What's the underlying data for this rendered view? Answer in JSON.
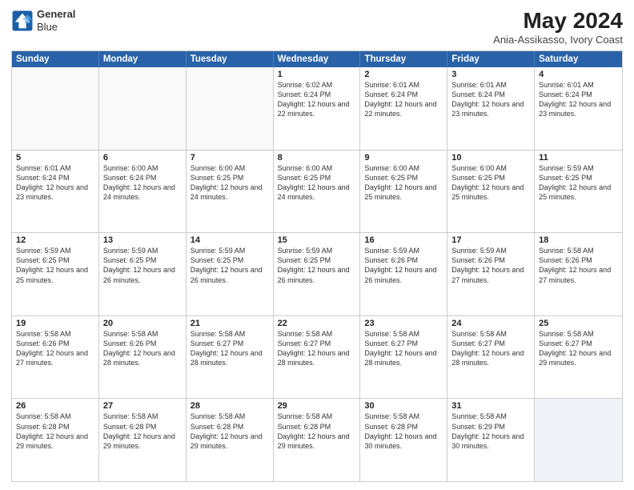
{
  "logo": {
    "line1": "General",
    "line2": "Blue"
  },
  "title": "May 2024",
  "subtitle": "Ania-Assikasso, Ivory Coast",
  "header_days": [
    "Sunday",
    "Monday",
    "Tuesday",
    "Wednesday",
    "Thursday",
    "Friday",
    "Saturday"
  ],
  "weeks": [
    {
      "cells": [
        {
          "day": "",
          "info": "",
          "empty": true
        },
        {
          "day": "",
          "info": "",
          "empty": true
        },
        {
          "day": "",
          "info": "",
          "empty": true
        },
        {
          "day": "1",
          "info": "Sunrise: 6:02 AM\nSunset: 6:24 PM\nDaylight: 12 hours\nand 22 minutes."
        },
        {
          "day": "2",
          "info": "Sunrise: 6:01 AM\nSunset: 6:24 PM\nDaylight: 12 hours\nand 22 minutes."
        },
        {
          "day": "3",
          "info": "Sunrise: 6:01 AM\nSunset: 6:24 PM\nDaylight: 12 hours\nand 23 minutes."
        },
        {
          "day": "4",
          "info": "Sunrise: 6:01 AM\nSunset: 6:24 PM\nDaylight: 12 hours\nand 23 minutes."
        }
      ]
    },
    {
      "cells": [
        {
          "day": "5",
          "info": "Sunrise: 6:01 AM\nSunset: 6:24 PM\nDaylight: 12 hours\nand 23 minutes."
        },
        {
          "day": "6",
          "info": "Sunrise: 6:00 AM\nSunset: 6:24 PM\nDaylight: 12 hours\nand 24 minutes."
        },
        {
          "day": "7",
          "info": "Sunrise: 6:00 AM\nSunset: 6:25 PM\nDaylight: 12 hours\nand 24 minutes."
        },
        {
          "day": "8",
          "info": "Sunrise: 6:00 AM\nSunset: 6:25 PM\nDaylight: 12 hours\nand 24 minutes."
        },
        {
          "day": "9",
          "info": "Sunrise: 6:00 AM\nSunset: 6:25 PM\nDaylight: 12 hours\nand 25 minutes."
        },
        {
          "day": "10",
          "info": "Sunrise: 6:00 AM\nSunset: 6:25 PM\nDaylight: 12 hours\nand 25 minutes."
        },
        {
          "day": "11",
          "info": "Sunrise: 5:59 AM\nSunset: 6:25 PM\nDaylight: 12 hours\nand 25 minutes."
        }
      ]
    },
    {
      "cells": [
        {
          "day": "12",
          "info": "Sunrise: 5:59 AM\nSunset: 6:25 PM\nDaylight: 12 hours\nand 25 minutes."
        },
        {
          "day": "13",
          "info": "Sunrise: 5:59 AM\nSunset: 6:25 PM\nDaylight: 12 hours\nand 26 minutes."
        },
        {
          "day": "14",
          "info": "Sunrise: 5:59 AM\nSunset: 6:25 PM\nDaylight: 12 hours\nand 26 minutes."
        },
        {
          "day": "15",
          "info": "Sunrise: 5:59 AM\nSunset: 6:25 PM\nDaylight: 12 hours\nand 26 minutes."
        },
        {
          "day": "16",
          "info": "Sunrise: 5:59 AM\nSunset: 6:26 PM\nDaylight: 12 hours\nand 26 minutes."
        },
        {
          "day": "17",
          "info": "Sunrise: 5:59 AM\nSunset: 6:26 PM\nDaylight: 12 hours\nand 27 minutes."
        },
        {
          "day": "18",
          "info": "Sunrise: 5:58 AM\nSunset: 6:26 PM\nDaylight: 12 hours\nand 27 minutes."
        }
      ]
    },
    {
      "cells": [
        {
          "day": "19",
          "info": "Sunrise: 5:58 AM\nSunset: 6:26 PM\nDaylight: 12 hours\nand 27 minutes."
        },
        {
          "day": "20",
          "info": "Sunrise: 5:58 AM\nSunset: 6:26 PM\nDaylight: 12 hours\nand 28 minutes."
        },
        {
          "day": "21",
          "info": "Sunrise: 5:58 AM\nSunset: 6:27 PM\nDaylight: 12 hours\nand 28 minutes."
        },
        {
          "day": "22",
          "info": "Sunrise: 5:58 AM\nSunset: 6:27 PM\nDaylight: 12 hours\nand 28 minutes."
        },
        {
          "day": "23",
          "info": "Sunrise: 5:58 AM\nSunset: 6:27 PM\nDaylight: 12 hours\nand 28 minutes."
        },
        {
          "day": "24",
          "info": "Sunrise: 5:58 AM\nSunset: 6:27 PM\nDaylight: 12 hours\nand 28 minutes."
        },
        {
          "day": "25",
          "info": "Sunrise: 5:58 AM\nSunset: 6:27 PM\nDaylight: 12 hours\nand 29 minutes."
        }
      ]
    },
    {
      "cells": [
        {
          "day": "26",
          "info": "Sunrise: 5:58 AM\nSunset: 6:28 PM\nDaylight: 12 hours\nand 29 minutes."
        },
        {
          "day": "27",
          "info": "Sunrise: 5:58 AM\nSunset: 6:28 PM\nDaylight: 12 hours\nand 29 minutes."
        },
        {
          "day": "28",
          "info": "Sunrise: 5:58 AM\nSunset: 6:28 PM\nDaylight: 12 hours\nand 29 minutes."
        },
        {
          "day": "29",
          "info": "Sunrise: 5:58 AM\nSunset: 6:28 PM\nDaylight: 12 hours\nand 29 minutes."
        },
        {
          "day": "30",
          "info": "Sunrise: 5:58 AM\nSunset: 6:28 PM\nDaylight: 12 hours\nand 30 minutes."
        },
        {
          "day": "31",
          "info": "Sunrise: 5:58 AM\nSunset: 6:29 PM\nDaylight: 12 hours\nand 30 minutes."
        },
        {
          "day": "",
          "info": "",
          "empty": true,
          "shaded": true
        }
      ]
    }
  ]
}
